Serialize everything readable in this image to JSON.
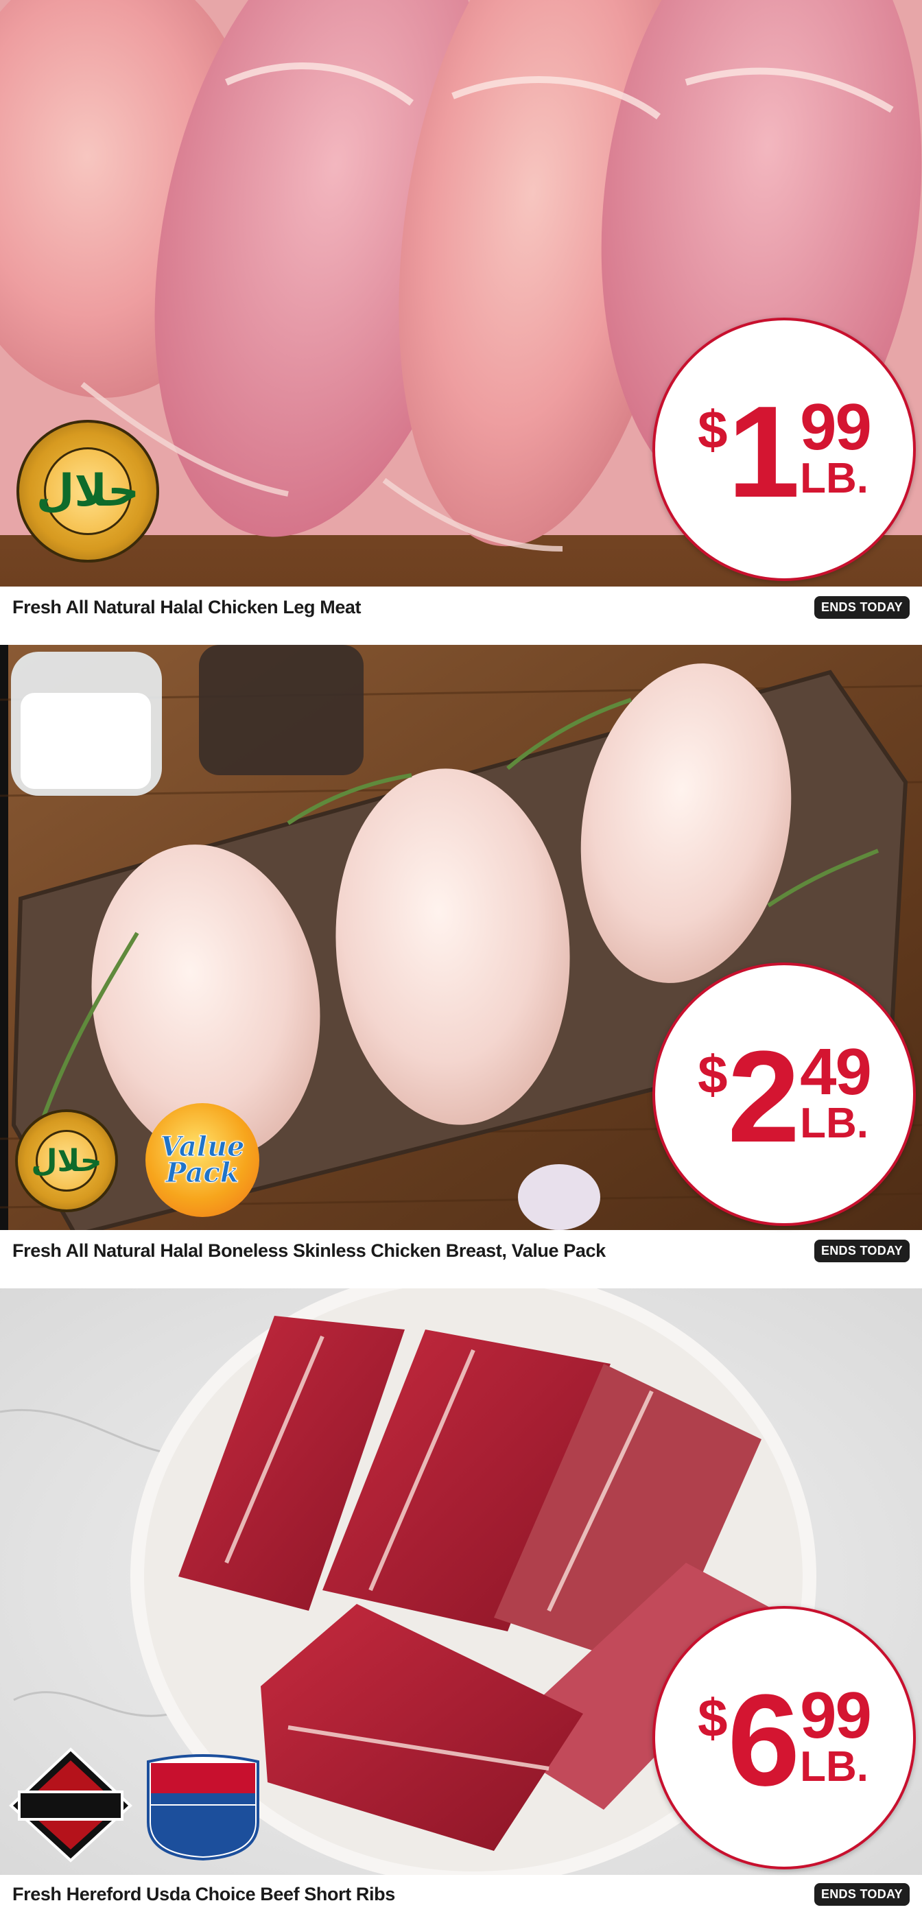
{
  "products": [
    {
      "caption": "Fresh All Natural Halal Chicken Leg Meat",
      "badge": "ENDS TODAY",
      "price": {
        "currency": "$",
        "dollars": "1",
        "cents": "99",
        "unit": "LB."
      },
      "seals": [
        "halal-seal"
      ]
    },
    {
      "caption": "Fresh All Natural Halal Boneless Skinless Chicken Breast, Value Pack",
      "badge": "ENDS TODAY",
      "price": {
        "currency": "$",
        "dollars": "2",
        "cents": "49",
        "unit": "LB."
      },
      "seals": [
        "halal-seal",
        "value-pack-badge"
      ],
      "value_pack": {
        "line1": "Value",
        "line2": "Pack"
      }
    },
    {
      "caption": "Fresh Hereford Usda Choice Beef Short Ribs",
      "badge": "ENDS TODAY",
      "price": {
        "currency": "$",
        "dollars": "6",
        "cents": "99",
        "unit": "LB."
      },
      "seals": [
        "hereford-beef-logo",
        "usda-choice-shield"
      ]
    }
  ],
  "colors": {
    "price_red": "#d41531",
    "badge_bg": "#1e1e1e",
    "caption_text": "#1a1a1a"
  }
}
